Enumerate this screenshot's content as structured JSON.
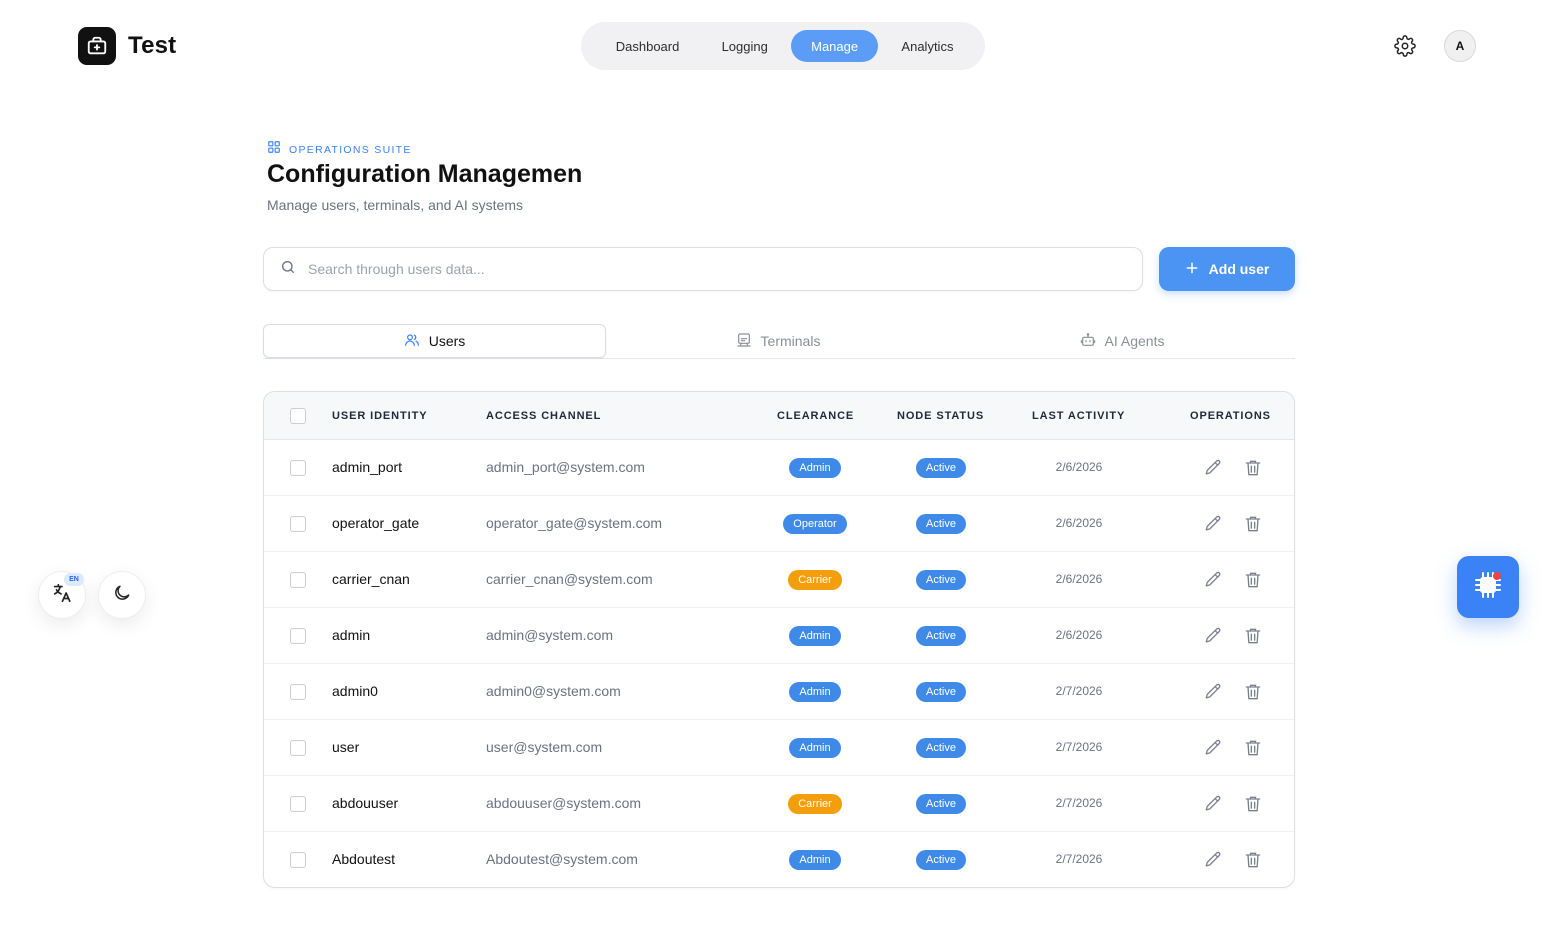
{
  "app": {
    "name": "Test",
    "logo_icon": "briefcase-plus-icon"
  },
  "nav": {
    "items": [
      {
        "label": "Dashboard",
        "active": false
      },
      {
        "label": "Logging",
        "active": false
      },
      {
        "label": "Manage",
        "active": true
      },
      {
        "label": "Analytics",
        "active": false
      }
    ]
  },
  "header": {
    "avatar_initial": "A",
    "settings_icon": "gear-icon"
  },
  "page": {
    "eyebrow": "OPERATIONS SUITE",
    "title": "Configuration Managemen",
    "subtitle": "Manage users, terminals, and AI systems"
  },
  "search": {
    "placeholder": "Search through users data...",
    "value": ""
  },
  "add_button": {
    "label": "Add user"
  },
  "tabs": [
    {
      "label": "Users",
      "icon": "users-icon",
      "active": true
    },
    {
      "label": "Terminals",
      "icon": "terminal-icon",
      "active": false
    },
    {
      "label": "AI Agents",
      "icon": "bot-icon",
      "active": false
    }
  ],
  "table": {
    "columns": [
      "USER IDENTITY",
      "ACCESS CHANNEL",
      "CLEARANCE",
      "NODE STATUS",
      "LAST ACTIVITY",
      "OPERATIONS"
    ],
    "rows": [
      {
        "name": "admin_port",
        "email": "admin_port@system.com",
        "clearance": "Admin",
        "status": "Active",
        "last_activity": "2/6/2026"
      },
      {
        "name": "operator_gate",
        "email": "operator_gate@system.com",
        "clearance": "Operator",
        "status": "Active",
        "last_activity": "2/6/2026"
      },
      {
        "name": "carrier_cnan",
        "email": "carrier_cnan@system.com",
        "clearance": "Carrier",
        "status": "Active",
        "last_activity": "2/6/2026"
      },
      {
        "name": "admin",
        "email": "admin@system.com",
        "clearance": "Admin",
        "status": "Active",
        "last_activity": "2/6/2026"
      },
      {
        "name": "admin0",
        "email": "admin0@system.com",
        "clearance": "Admin",
        "status": "Active",
        "last_activity": "2/7/2026"
      },
      {
        "name": "user",
        "email": "user@system.com",
        "clearance": "Admin",
        "status": "Active",
        "last_activity": "2/7/2026"
      },
      {
        "name": "abdouuser",
        "email": "abdouuser@system.com",
        "clearance": "Carrier",
        "status": "Active",
        "last_activity": "2/7/2026"
      },
      {
        "name": "Abdoutest",
        "email": "Abdoutest@system.com",
        "clearance": "Admin",
        "status": "Active",
        "last_activity": "2/7/2026"
      }
    ]
  },
  "floating": {
    "language_code": "EN",
    "language_icon": "translate-icon",
    "theme_icon": "moon-icon",
    "assistant_icon": "chip-icon"
  },
  "colors": {
    "primary": "#4b94f3",
    "badge_blue": "#3f8ae8",
    "badge_carrier": "#f59e0b",
    "notification_dot": "#ef4444"
  }
}
